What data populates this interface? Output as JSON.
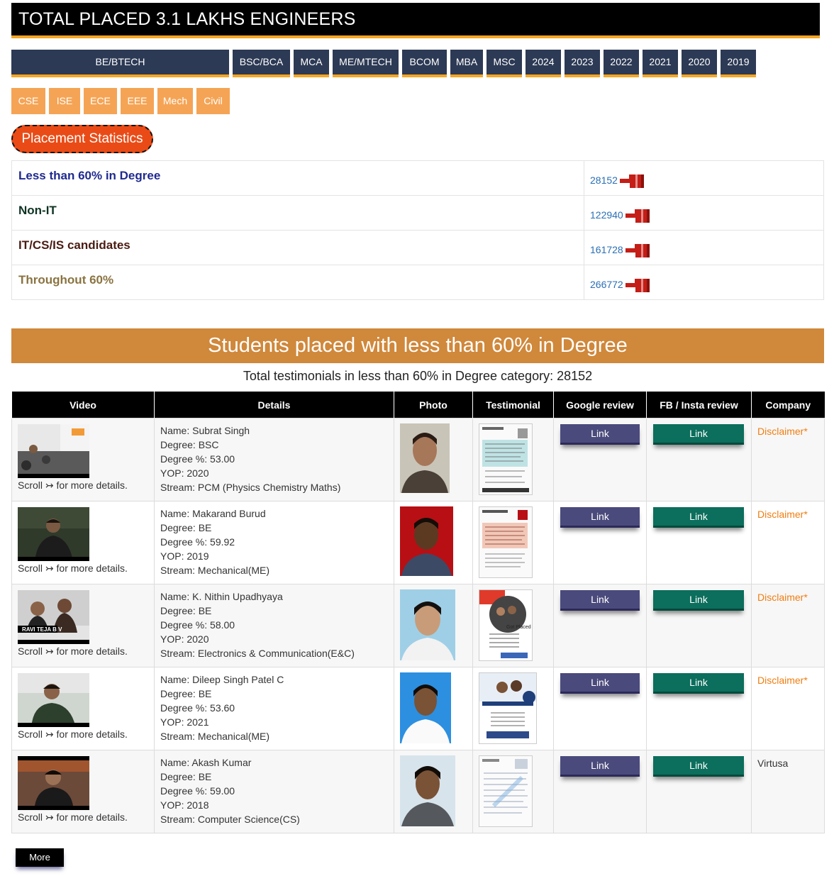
{
  "header": {
    "title": "TOTAL PLACED 3.1 LAKHS ENGINEERS"
  },
  "degree_tabs": [
    "BE/BTECH",
    "BSC/BCA",
    "MCA",
    "ME/MTECH",
    "BCOM",
    "MBA",
    "MSC",
    "2024",
    "2023",
    "2022",
    "2021",
    "2020",
    "2019"
  ],
  "branch_tabs": [
    "CSE",
    "ISE",
    "ECE",
    "EEE",
    "Mech",
    "Civil"
  ],
  "stats_badge": "Placement Statistics",
  "stats": [
    {
      "label": "Less than 60% in Degree",
      "count": "28152",
      "color": "#1f2a8f"
    },
    {
      "label": "Non-IT",
      "count": "122940",
      "color": "#0e3323"
    },
    {
      "label": "IT/CS/IS candidates",
      "count": "161728",
      "color": "#4a1b12"
    },
    {
      "label": "Throughout 60%",
      "count": "266772",
      "color": "#8a7340"
    }
  ],
  "section_title": "Students placed with less than 60% in Degree",
  "subtitle": "Total testimonials in less than 60% in Degree category: 28152",
  "table_headers": [
    "Video",
    "Details",
    "Photo",
    "Testimonial",
    "Google review",
    "FB / Insta review",
    "Company"
  ],
  "rows": [
    {
      "scroll_note": "Scroll ↣ for more details.",
      "name": "Name: Subrat Singh",
      "degree": "Degree: BSC",
      "pct": "Degree %: 53.00",
      "yop": "YOP: 2020",
      "stream": "Stream: PCM (Physics Chemistry Maths)",
      "google": "Link",
      "fb": "Link",
      "company": "Disclaimer*"
    },
    {
      "scroll_note": "Scroll ↣ for more details.",
      "name": "Name: Makarand Burud",
      "degree": "Degree: BE",
      "pct": "Degree %: 59.92",
      "yop": "YOP: 2019",
      "stream": "Stream: Mechanical(ME)",
      "google": "Link",
      "fb": "Link",
      "company": "Disclaimer*"
    },
    {
      "scroll_note": "Scroll ↣ for more details.",
      "name": "Name: K. Nithin Upadhyaya",
      "degree": "Degree: BE",
      "pct": "Degree %: 58.00",
      "yop": "YOP: 2020",
      "stream": "Stream: Electronics & Communication(E&C)",
      "google": "Link",
      "fb": "Link",
      "company": "Disclaimer*",
      "video_caption": "RAVI TEJA B V"
    },
    {
      "scroll_note": "Scroll ↣ for more details.",
      "name": "Name: Dileep Singh Patel C",
      "degree": "Degree: BE",
      "pct": "Degree %: 53.60",
      "yop": "YOP: 2021",
      "stream": "Stream: Mechanical(ME)",
      "google": "Link",
      "fb": "Link",
      "company": "Disclaimer*"
    },
    {
      "scroll_note": "Scroll ↣ for more details.",
      "name": "Name: Akash Kumar",
      "degree": "Degree: BE",
      "pct": "Degree %: 59.00",
      "yop": "YOP: 2018",
      "stream": "Stream: Computer Science(CS)",
      "google": "Link",
      "fb": "Link",
      "company": "Virtusa"
    }
  ],
  "more_button": "More"
}
